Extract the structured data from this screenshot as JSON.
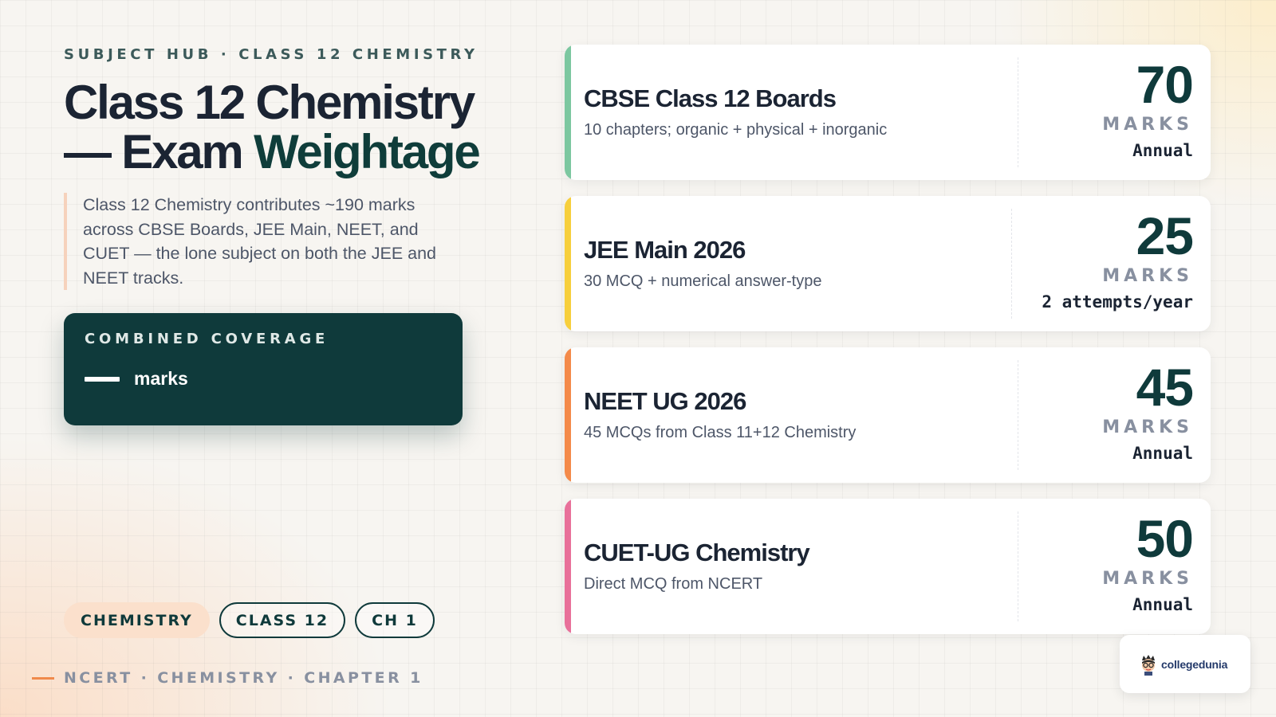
{
  "header": {
    "eyebrow": "SUBJECT HUB · CLASS 12 CHEMISTRY",
    "title_main": "Class 12 Chemistry — Exam",
    "title_accent": "Weightage"
  },
  "intro": {
    "text": "Class 12 Chemistry contributes ~190 marks across CBSE Boards, JEE Main, NEET, and CUET — the lone subject on both the JEE and NEET tracks."
  },
  "coverage": {
    "label": "COMBINED COVERAGE",
    "value": "—",
    "unit": "marks"
  },
  "chips": [
    {
      "label": "CHEMISTRY"
    },
    {
      "label": "CLASS 12"
    },
    {
      "label": "CH 1"
    }
  ],
  "footer": {
    "text": "NCERT · CHEMISTRY · CHAPTER 1"
  },
  "colors": {
    "accent_teal": "#0f3a3b",
    "bar_green": "#7cc7a0",
    "bar_yellow": "#f7cf3c",
    "bar_orange": "#f48a4a",
    "bar_pink": "#e8709a"
  },
  "exams": [
    {
      "name": "CBSE Class 12 Boards",
      "desc": "10 chapters; organic + physical + inorganic",
      "value": "70",
      "unit": "MARKS",
      "freq": "Annual",
      "color": "#7cc7a0"
    },
    {
      "name": "JEE Main 2026",
      "desc": "30 MCQ + numerical answer-type",
      "value": "25",
      "unit": "MARKS",
      "freq": "2 attempts/year",
      "color": "#f7cf3c"
    },
    {
      "name": "NEET UG 2026",
      "desc": "45 MCQs from Class 11+12 Chemistry",
      "value": "45",
      "unit": "MARKS",
      "freq": "Annual",
      "color": "#f48a4a"
    },
    {
      "name": "CUET-UG Chemistry",
      "desc": "Direct MCQ from NCERT",
      "value": "50",
      "unit": "MARKS",
      "freq": "Annual",
      "color": "#e8709a"
    }
  ],
  "logo": {
    "text": "collegedunia",
    "icon": "mascot-icon"
  }
}
